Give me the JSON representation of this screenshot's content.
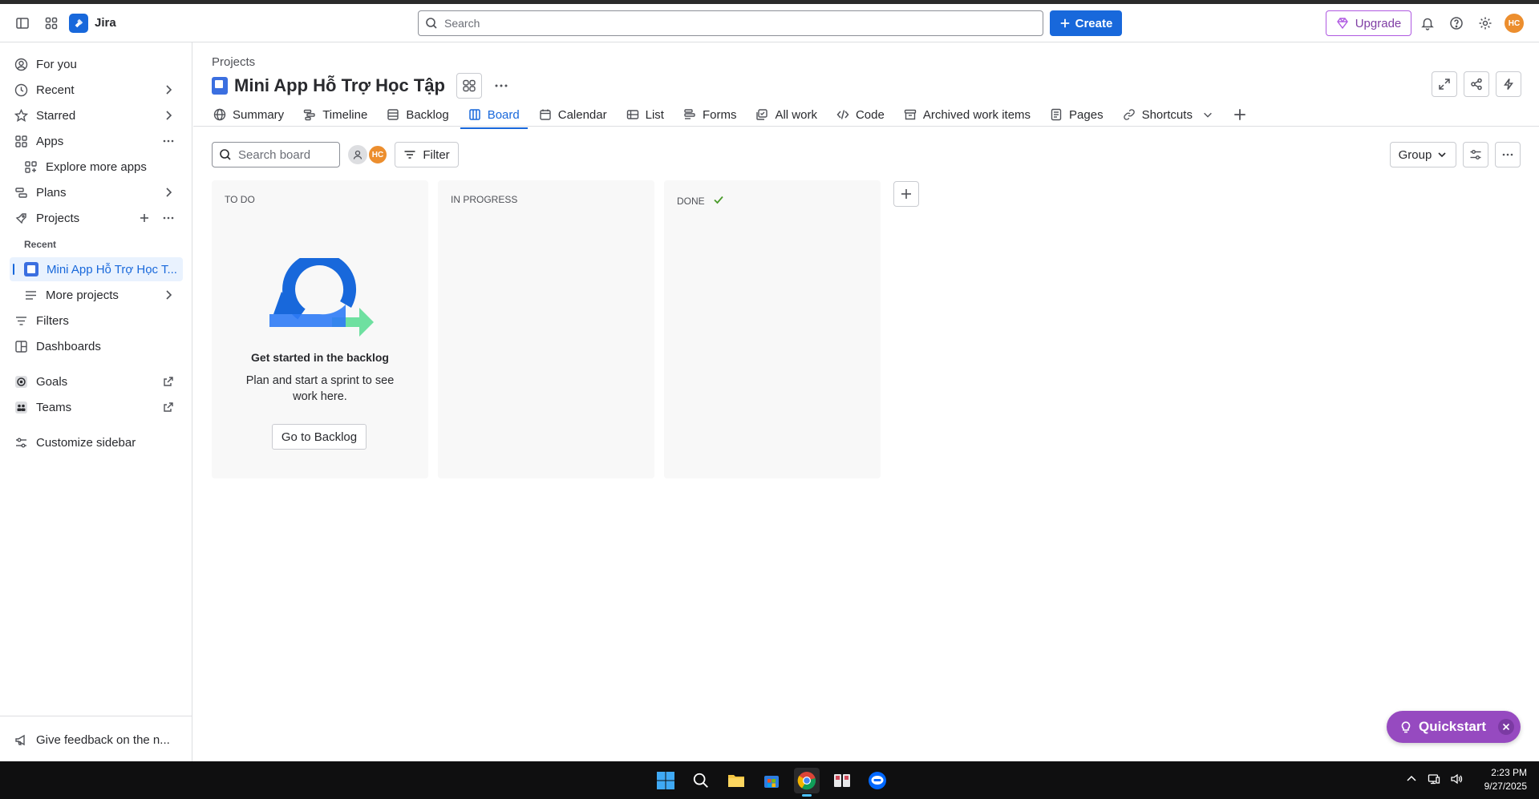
{
  "topnav": {
    "app_name": "Jira",
    "search_placeholder": "Search",
    "create_label": "Create",
    "upgrade_label": "Upgrade",
    "user_initials": "HC"
  },
  "sidebar": {
    "for_you": "For you",
    "recent": "Recent",
    "starred": "Starred",
    "apps": "Apps",
    "explore_apps": "Explore more apps",
    "plans": "Plans",
    "projects": "Projects",
    "recent_heading": "Recent",
    "recent_project": "Mini App Hỗ Trợ Học T...",
    "more_projects": "More projects",
    "filters": "Filters",
    "dashboards": "Dashboards",
    "goals": "Goals",
    "teams": "Teams",
    "customize": "Customize sidebar",
    "feedback": "Give feedback on the n..."
  },
  "header": {
    "breadcrumb": "Projects",
    "project_title": "Mini App Hỗ Trợ Học Tập"
  },
  "tabs": [
    {
      "label": "Summary",
      "icon": "globe-icon"
    },
    {
      "label": "Timeline",
      "icon": "timeline-icon"
    },
    {
      "label": "Backlog",
      "icon": "backlog-icon"
    },
    {
      "label": "Board",
      "icon": "board-icon",
      "active": true
    },
    {
      "label": "Calendar",
      "icon": "calendar-icon"
    },
    {
      "label": "List",
      "icon": "list-icon"
    },
    {
      "label": "Forms",
      "icon": "forms-icon"
    },
    {
      "label": "All work",
      "icon": "all-work-icon"
    },
    {
      "label": "Code",
      "icon": "code-icon"
    },
    {
      "label": "Archived work items",
      "icon": "archive-icon"
    },
    {
      "label": "Pages",
      "icon": "pages-icon"
    },
    {
      "label": "Shortcuts",
      "icon": "link-icon"
    }
  ],
  "board": {
    "search_placeholder": "Search board",
    "filter_label": "Filter",
    "group_label": "Group",
    "avatar_initials": "HC",
    "columns": [
      {
        "title": "TO DO"
      },
      {
        "title": "IN PROGRESS"
      },
      {
        "title": "DONE"
      }
    ],
    "empty_title": "Get started in the backlog",
    "empty_desc": "Plan and start a sprint to see work here.",
    "empty_button": "Go to Backlog"
  },
  "quickstart": {
    "label": "Quickstart"
  },
  "taskbar": {
    "time": "2:23 PM",
    "date": "9/27/2025"
  },
  "colors": {
    "accent": "#1868db",
    "upgrade": "#803fa5",
    "quickstart": "#964ac0",
    "avatar": "#ec8e2e"
  }
}
